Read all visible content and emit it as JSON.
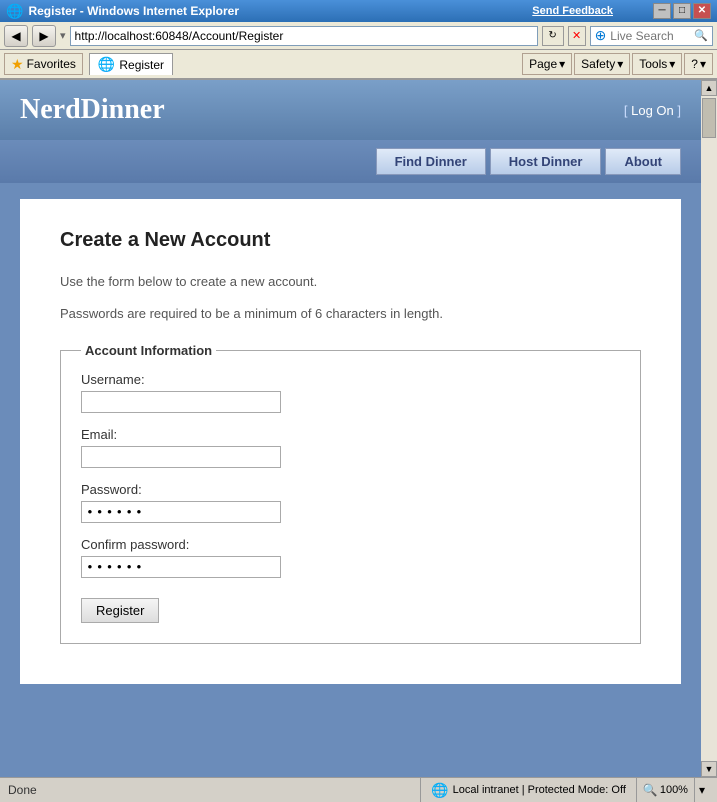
{
  "titlebar": {
    "title": "Register - Windows Internet Explorer",
    "feedback": "Send Feedback",
    "minimize": "─",
    "maximize": "□",
    "close": "✕"
  },
  "addressbar": {
    "back": "◀",
    "forward": "▶",
    "dropdown": "▾",
    "url": "http://localhost:60848/Account/Register",
    "refresh": "↻",
    "stop": "✕",
    "live_search_placeholder": "Live Search",
    "search_label": "Search"
  },
  "toolbar": {
    "favorites_label": "Favorites",
    "tab_label": "Register",
    "page_label": "Page",
    "safety_label": "Safety",
    "tools_label": "Tools",
    "help_icon": "?"
  },
  "header": {
    "site_title": "NerdDinner",
    "login_prefix": "[",
    "login_text": " Log On ",
    "login_suffix": "]"
  },
  "nav": {
    "find_dinner": "Find Dinner",
    "host_dinner": "Host Dinner",
    "about": "About"
  },
  "page": {
    "heading": "Create a New Account",
    "intro1": "Use the form below to create a new account.",
    "intro2": "Passwords are required to be a minimum of 6 characters in length.",
    "fieldset_legend": "Account Information",
    "username_label": "Username:",
    "email_label": "Email:",
    "password_label": "Password:",
    "password_value": "••••••",
    "confirm_password_label": "Confirm password:",
    "confirm_password_value": "••••••",
    "register_btn": "Register"
  },
  "statusbar": {
    "status_text": "Done",
    "zone_text": "Local intranet | Protected Mode: Off",
    "zoom_text": "100%"
  }
}
